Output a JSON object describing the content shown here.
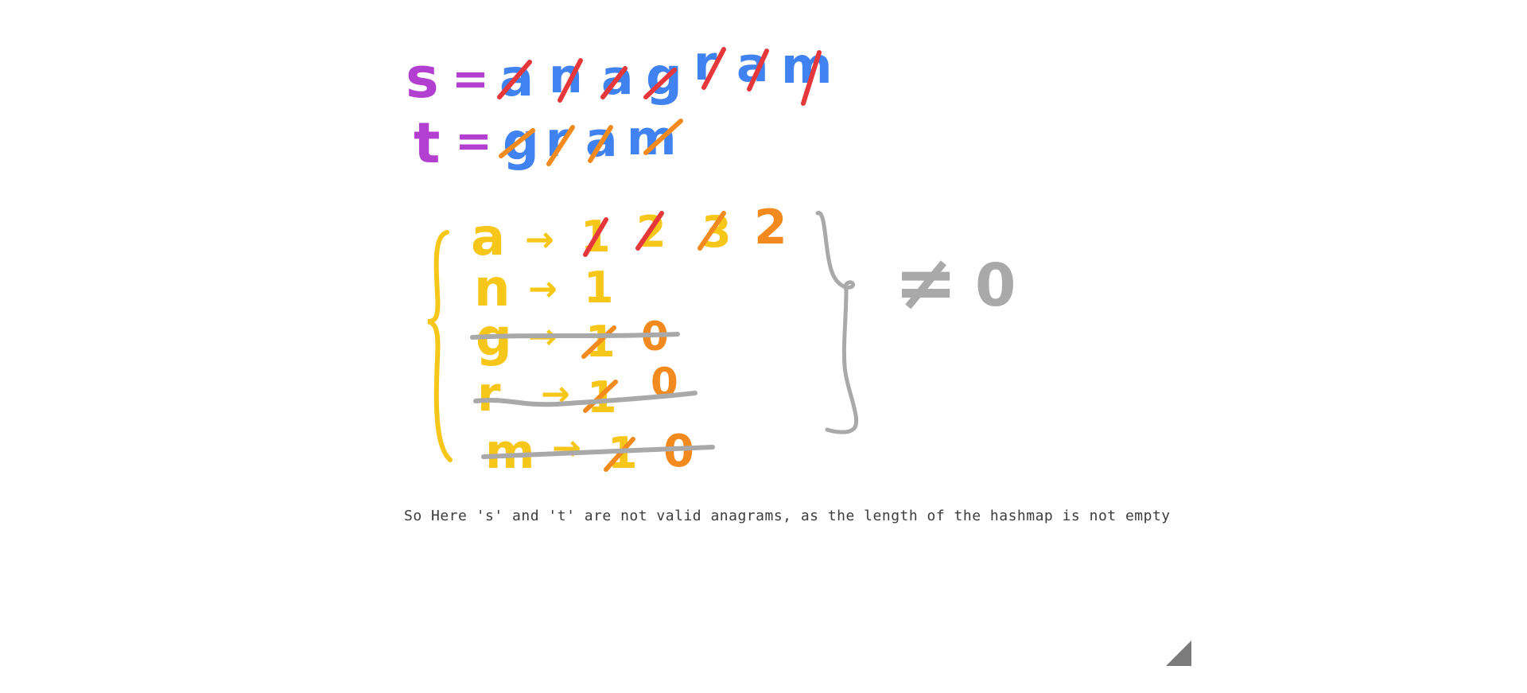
{
  "drawing": {
    "s_label": "s",
    "t_label": "t",
    "equals": "=",
    "s_letters": [
      "a",
      "n",
      "a",
      "g",
      "r",
      "a",
      "m"
    ],
    "t_letters": [
      "g",
      "r",
      "a",
      "m"
    ],
    "map_rows": [
      {
        "key": "a",
        "arrow": "→",
        "counts": [
          "1",
          "2",
          "3",
          "2"
        ]
      },
      {
        "key": "n",
        "arrow": "→",
        "counts": [
          "1"
        ]
      },
      {
        "key": "g",
        "arrow": "→",
        "counts": [
          "1",
          "0"
        ]
      },
      {
        "key": "r",
        "arrow": "→",
        "counts": [
          "1",
          "0"
        ]
      },
      {
        "key": "m",
        "arrow": "→",
        "counts": [
          "1",
          "0"
        ]
      }
    ],
    "not_equal": "≠",
    "zero": "0"
  },
  "caption": "So Here 's' and 't' are not valid anagrams, as the length of the hashmap is not empty",
  "colors": {
    "purple": "#b23fd0",
    "blue": "#3f82f0",
    "red": "#e6383a",
    "orange": "#f38a1e",
    "yellow": "#f6c619",
    "gray": "#a9a9a9",
    "text": "#3c3c3c",
    "handle": "#7b7b7b"
  }
}
